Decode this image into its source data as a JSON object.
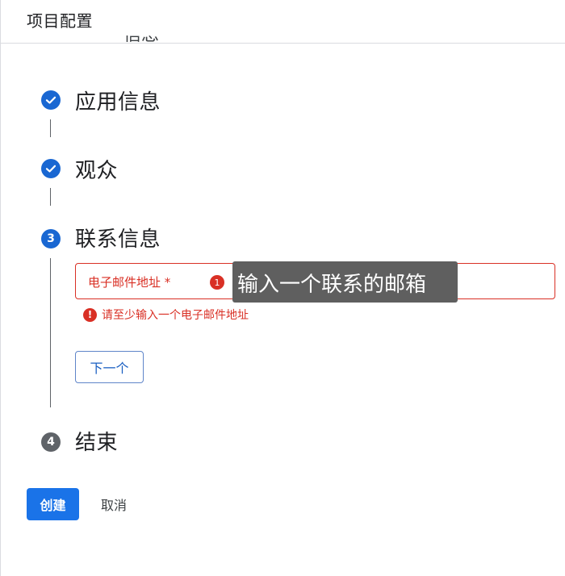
{
  "header": {
    "title": "项目配置"
  },
  "steps": [
    {
      "label": "信息",
      "state": "done",
      "partially_visible": true
    },
    {
      "label": "应用信息",
      "state": "done",
      "icon": "check-icon"
    },
    {
      "label": "观众",
      "state": "done",
      "icon": "check-icon"
    },
    {
      "label": "联系信息",
      "state": "active",
      "number": "3"
    },
    {
      "label": "结束",
      "state": "todo",
      "number": "4"
    }
  ],
  "contact_step": {
    "email_field": {
      "label": "电子邮件地址 *",
      "value": "",
      "error_count": "1"
    },
    "tooltip": "输入一个联系的邮箱",
    "error_message": "请至少输入一个电子邮件地址",
    "error_icon": "!",
    "next_button": "下一个"
  },
  "actions": {
    "create": "创建",
    "cancel": "取消"
  },
  "colors": {
    "primary": "#1a73e8",
    "step_blue": "#1967d2",
    "error": "#d93025",
    "tooltip_bg": "#5f5f5f",
    "todo_gray": "#5f6368"
  }
}
